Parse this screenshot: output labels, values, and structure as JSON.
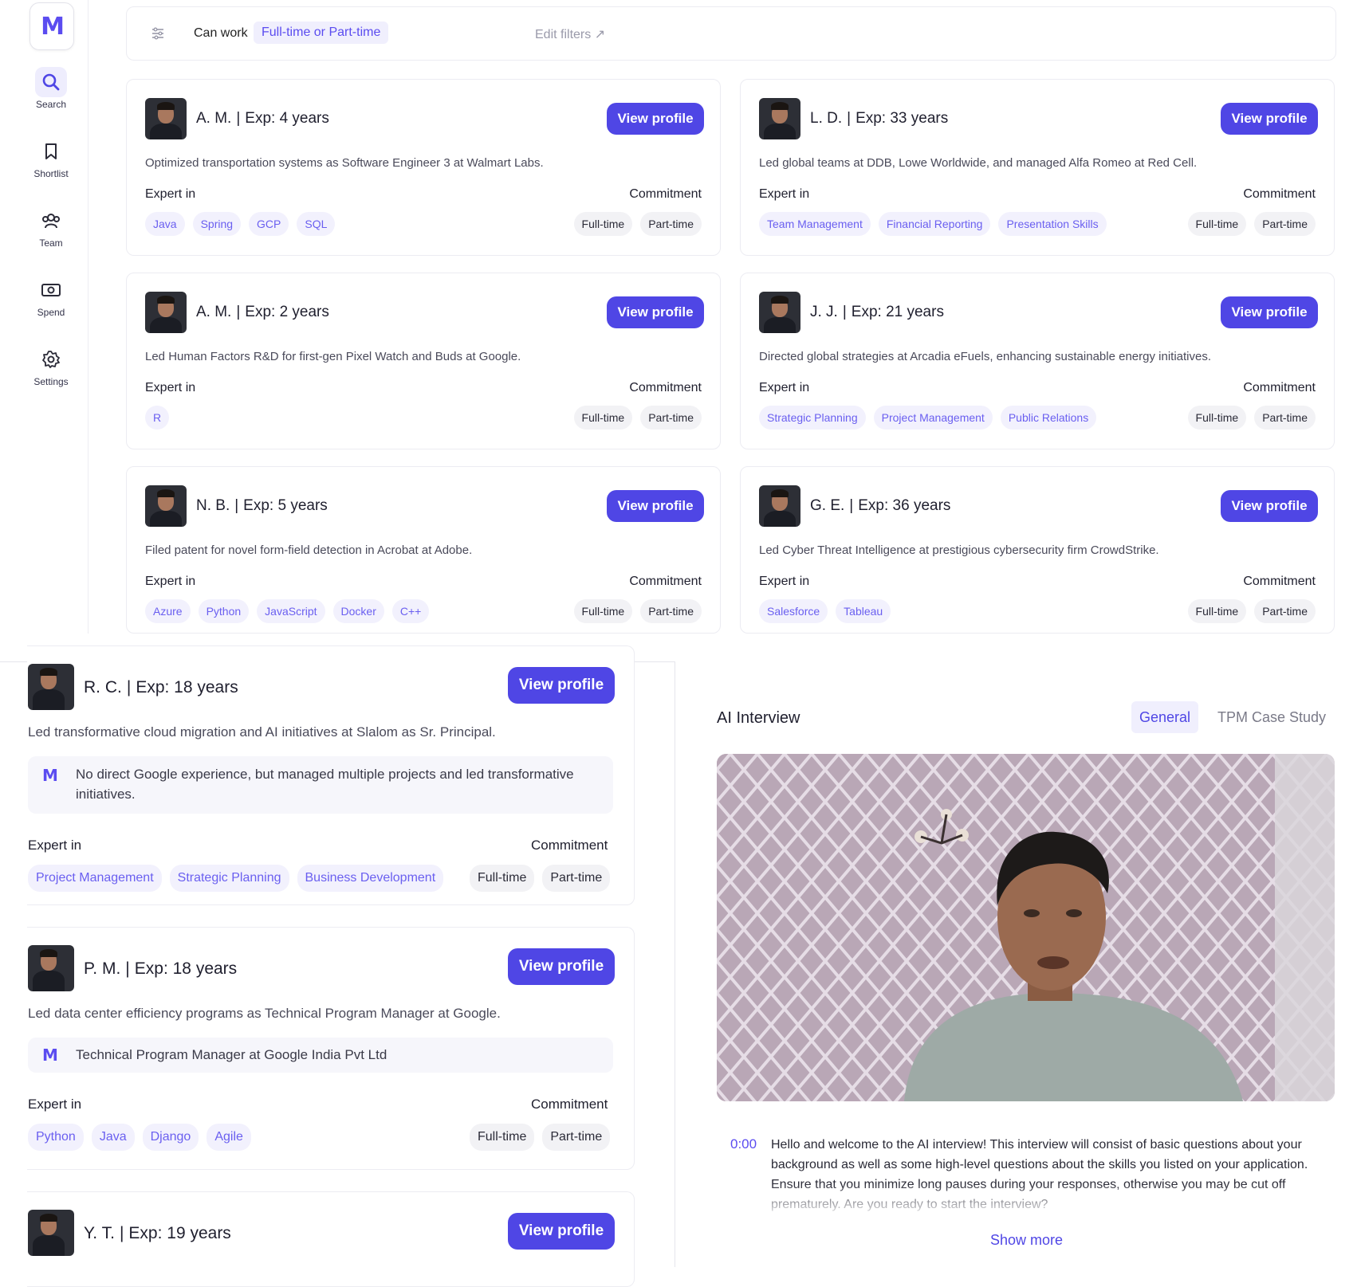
{
  "sidebar": {
    "logo": "M",
    "items": [
      {
        "label": "Search",
        "icon": "search-icon"
      },
      {
        "label": "Shortlist",
        "icon": "bookmark-icon"
      },
      {
        "label": "Team",
        "icon": "team-icon"
      },
      {
        "label": "Spend",
        "icon": "money-icon"
      },
      {
        "label": "Settings",
        "icon": "gear-icon"
      }
    ]
  },
  "filters": {
    "label": "Can work",
    "value": "Full-time or Part-time",
    "edit": "Edit filters ↗"
  },
  "labels": {
    "expert_in": "Expert in",
    "commitment": "Commitment",
    "view_profile": "View profile"
  },
  "cards": [
    {
      "initials": "A. M.",
      "exp": "Exp: 4 years",
      "desc": "Optimized transportation systems as Software Engineer 3 at Walmart Labs.",
      "skills": [
        "Java",
        "Spring",
        "GCP",
        "SQL"
      ],
      "commitment": [
        "Full-time",
        "Part-time"
      ]
    },
    {
      "initials": "L. D.",
      "exp": "Exp: 33 years",
      "desc": "Led global teams at DDB, Lowe Worldwide, and managed Alfa Romeo at Red Cell.",
      "skills": [
        "Team Management",
        "Financial Reporting",
        "Presentation Skills"
      ],
      "commitment": [
        "Full-time",
        "Part-time"
      ]
    },
    {
      "initials": "A. M.",
      "exp": "Exp: 2 years",
      "desc": "Led Human Factors R&D for first-gen Pixel Watch and Buds at Google.",
      "skills": [
        "R"
      ],
      "commitment": [
        "Full-time",
        "Part-time"
      ]
    },
    {
      "initials": "J. J.",
      "exp": "Exp: 21 years",
      "desc": "Directed global strategies at Arcadia eFuels, enhancing sustainable energy initiatives.",
      "skills": [
        "Strategic Planning",
        "Project Management",
        "Public Relations"
      ],
      "commitment": [
        "Full-time",
        "Part-time"
      ]
    },
    {
      "initials": "N. B.",
      "exp": "Exp: 5 years",
      "desc": "Filed patent for novel form-field detection in Acrobat at Adobe.",
      "skills": [
        "Azure",
        "Python",
        "JavaScript",
        "Docker",
        "C++"
      ],
      "commitment": [
        "Full-time",
        "Part-time"
      ]
    },
    {
      "initials": "G. E.",
      "exp": "Exp: 36 years",
      "desc": "Led Cyber Threat Intelligence at prestigious cybersecurity firm CrowdStrike.",
      "skills": [
        "Salesforce",
        "Tableau"
      ],
      "commitment": [
        "Full-time",
        "Part-time"
      ]
    }
  ],
  "list": [
    {
      "initials": "R. C.",
      "exp": "Exp: 18 years",
      "desc": "Led transformative cloud migration and AI initiatives at Slalom as Sr. Principal.",
      "note": "No direct Google experience, but managed multiple projects and led transformative initiatives.",
      "skills": [
        "Project Management",
        "Strategic Planning",
        "Business Development"
      ],
      "commitment": [
        "Full-time",
        "Part-time"
      ]
    },
    {
      "initials": "P. M.",
      "exp": "Exp: 18 years",
      "desc": "Led data center efficiency programs as Technical Program Manager at Google.",
      "note": "Technical Program Manager at Google India Pvt Ltd",
      "skills": [
        "Python",
        "Java",
        "Django",
        "Agile"
      ],
      "commitment": [
        "Full-time",
        "Part-time"
      ]
    },
    {
      "initials": "Y. T.",
      "exp": "Exp: 19 years"
    }
  ],
  "ai_interview": {
    "title": "AI Interview",
    "tabs": [
      "General",
      "TPM Case Study"
    ],
    "active_tab": "General",
    "transcript_time": "0:00",
    "transcript": "Hello and welcome to the AI interview! This interview will consist of basic questions about your background as well as some high-level questions about the skills you listed on your application. Ensure that you minimize long pauses during your responses, otherwise you may be cut off prematurely. Are you ready to start the interview?",
    "show_more": "Show more"
  },
  "colors": {
    "accent": "#4f46e5",
    "chip_bg": "#f2f1fd",
    "chip_text": "#6a5ff0"
  }
}
